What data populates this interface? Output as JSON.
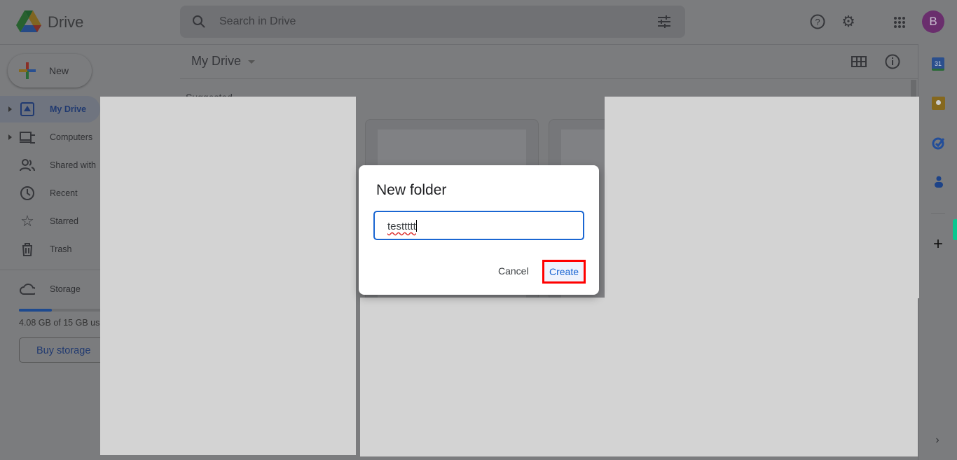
{
  "app": {
    "name": "Drive"
  },
  "header": {
    "search_placeholder": "Search in Drive",
    "avatar_letter": "B"
  },
  "sidebar": {
    "new_label": "New",
    "items": [
      {
        "label": "My Drive",
        "selected": true
      },
      {
        "label": "Computers"
      },
      {
        "label": "Shared with"
      },
      {
        "label": "Recent"
      },
      {
        "label": "Starred"
      },
      {
        "label": "Trash"
      }
    ],
    "storage": {
      "label": "Storage",
      "usage_text": "4.08 GB of 15 GB us",
      "used_fraction": 0.272,
      "buy_label": "Buy storage"
    }
  },
  "main": {
    "title": "My Drive",
    "section": "Suggested"
  },
  "dialog": {
    "title": "New folder",
    "input_value": "testtttt",
    "cancel_label": "Cancel",
    "create_label": "Create"
  },
  "colors": {
    "accent": "#1a66d2",
    "highlight_box": "#ff0000"
  }
}
